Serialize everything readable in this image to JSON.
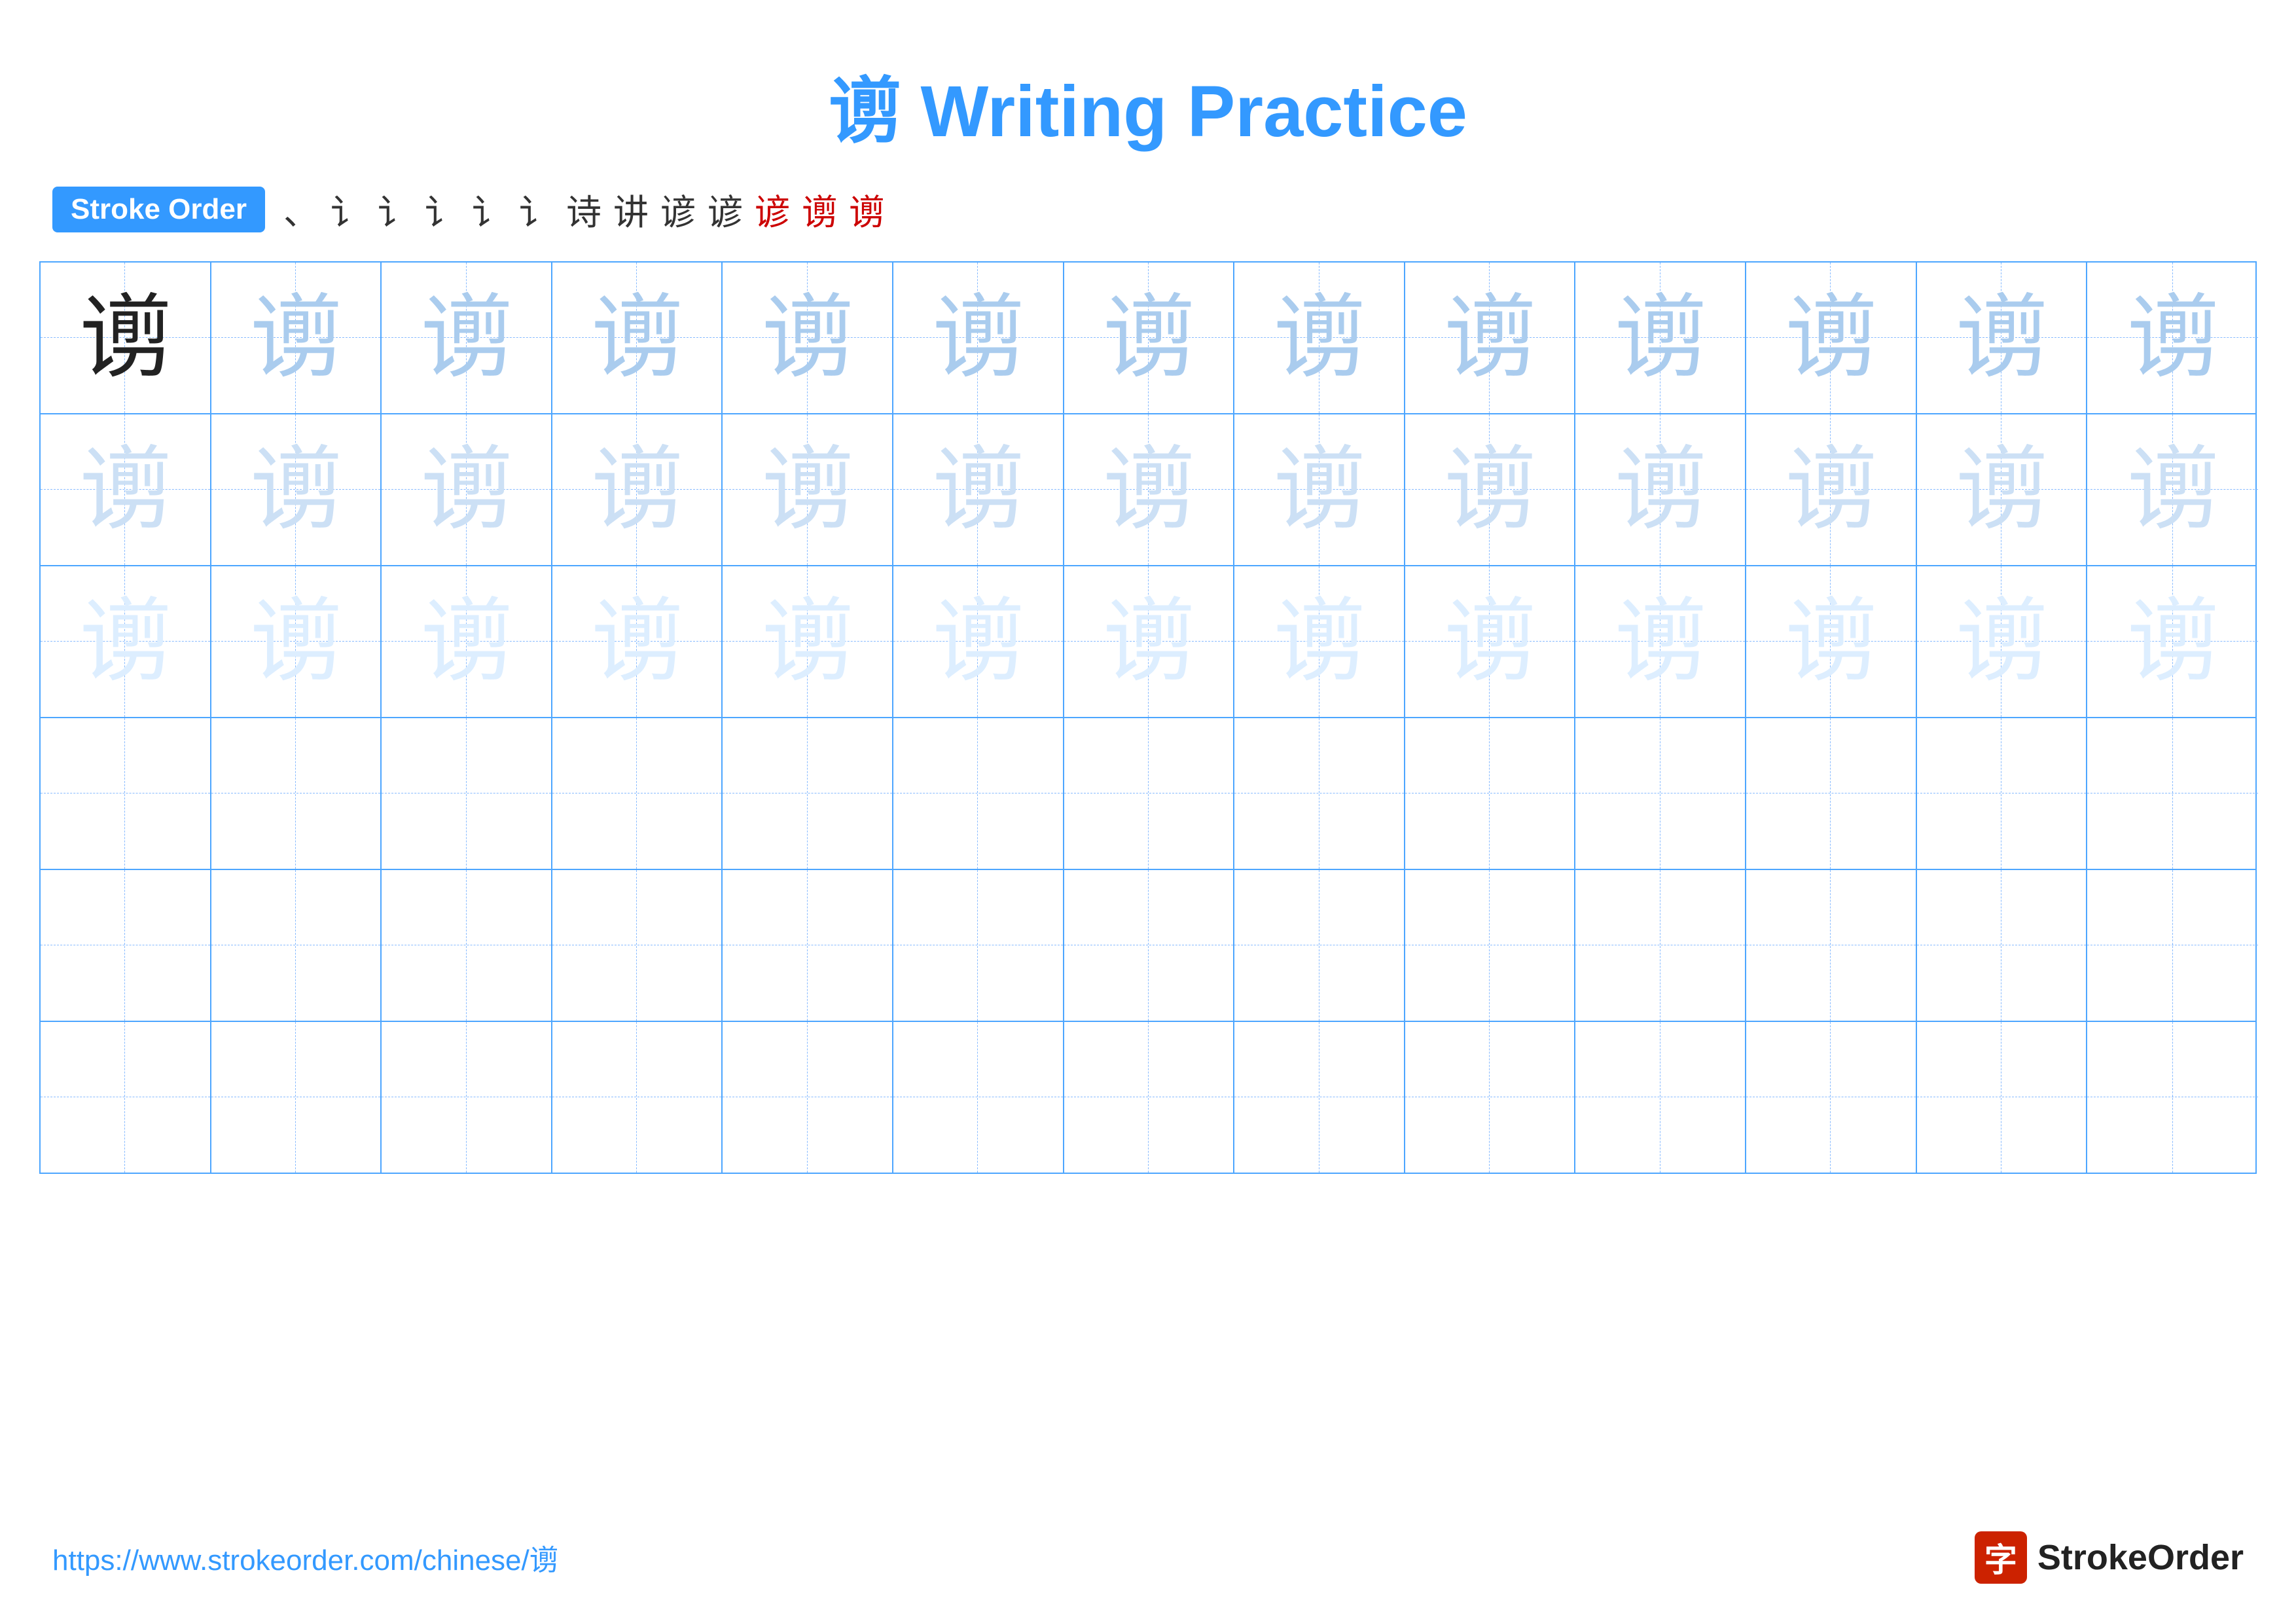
{
  "title": {
    "char": "谫",
    "rest": " Writing Practice",
    "full": "谫 Writing Practice"
  },
  "stroke_order": {
    "badge": "Stroke Order",
    "steps": [
      "、",
      "讠",
      "讠",
      "讠",
      "讠",
      "讠",
      "诗",
      "讲",
      "谚",
      "谚",
      "谚",
      "谫",
      "谫"
    ]
  },
  "grid": {
    "char": "谫",
    "rows": 6,
    "cols": 13
  },
  "footer": {
    "url": "https://www.strokeorder.com/chinese/谫",
    "logo_text": "StrokeOrder",
    "logo_icon": "字"
  }
}
